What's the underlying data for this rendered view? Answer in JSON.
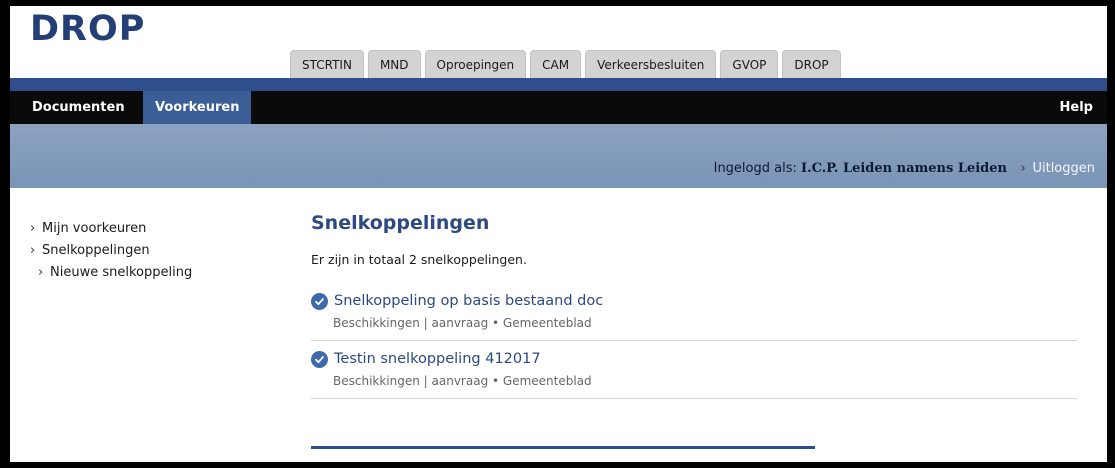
{
  "logo": "DROP",
  "site_tabs": [
    "STCRTIN",
    "MND",
    "Oproepingen",
    "CAM",
    "Verkeersbesluiten",
    "GVOP",
    "DROP"
  ],
  "nav": {
    "documenten": "Documenten",
    "voorkeuren": "Voorkeuren",
    "help": "Help"
  },
  "login": {
    "label": "Ingelogd als:",
    "name": "I.C.P. Leiden namens Leiden",
    "logout": "Uitloggen"
  },
  "sidebar": {
    "items": [
      {
        "label": "Mijn voorkeuren"
      },
      {
        "label": "Snelkoppelingen"
      },
      {
        "label": "Nieuwe snelkoppeling"
      }
    ]
  },
  "main": {
    "title": "Snelkoppelingen",
    "summary": "Er zijn in totaal 2 snelkoppelingen.",
    "items": [
      {
        "title": "Snelkoppeling op basis bestaand doc",
        "meta": "Beschikkingen | aanvraag • Gemeenteblad"
      },
      {
        "title": "Testin snelkoppeling 412017",
        "meta": "Beschikkingen | aanvraag • Gemeenteblad"
      }
    ]
  },
  "icons": {
    "chevron": "chevron-right-icon",
    "check": "check-circle-icon"
  },
  "colors": {
    "brand_blue": "#2f4e8c",
    "nav_active": "#3b5d95",
    "link": "#2c4a80"
  }
}
